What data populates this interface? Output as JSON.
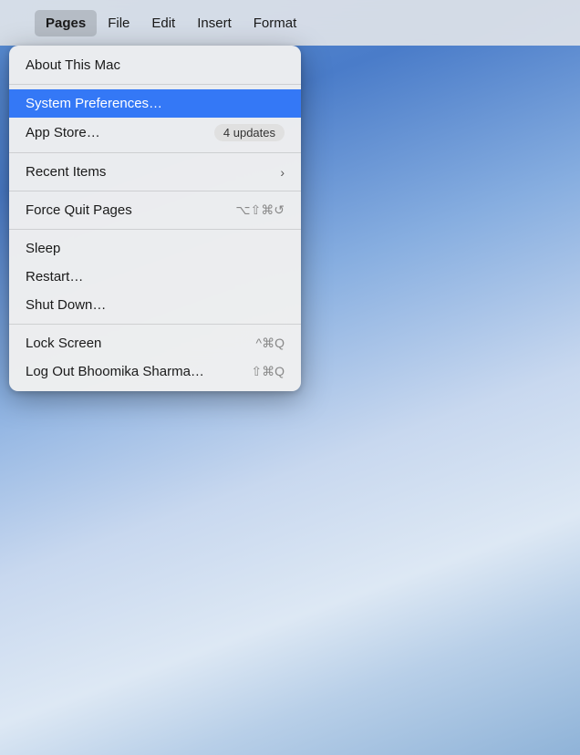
{
  "desktop": {
    "bg_description": "macOS blue sky background"
  },
  "menubar": {
    "apple_symbol": "",
    "items": [
      {
        "id": "pages",
        "label": "Pages",
        "bold": true
      },
      {
        "id": "file",
        "label": "File",
        "bold": false
      },
      {
        "id": "edit",
        "label": "Edit",
        "bold": false
      },
      {
        "id": "insert",
        "label": "Insert",
        "bold": false
      },
      {
        "id": "format",
        "label": "Format",
        "bold": false
      }
    ]
  },
  "dropdown": {
    "items": [
      {
        "id": "about",
        "label": "About This Mac",
        "shortcut": "",
        "badge": "",
        "chevron": false,
        "divider_after": true,
        "highlighted": false,
        "disabled": false
      },
      {
        "id": "system-prefs",
        "label": "System Preferences…",
        "shortcut": "",
        "badge": "",
        "chevron": false,
        "divider_after": false,
        "highlighted": true,
        "disabled": false
      },
      {
        "id": "app-store",
        "label": "App Store…",
        "shortcut": "",
        "badge": "4 updates",
        "chevron": false,
        "divider_after": true,
        "highlighted": false,
        "disabled": false
      },
      {
        "id": "recent-items",
        "label": "Recent Items",
        "shortcut": "",
        "badge": "",
        "chevron": true,
        "divider_after": true,
        "highlighted": false,
        "disabled": false
      },
      {
        "id": "force-quit",
        "label": "Force Quit Pages",
        "shortcut": "⌥⇧⌘↺",
        "badge": "",
        "chevron": false,
        "divider_after": true,
        "highlighted": false,
        "disabled": false
      },
      {
        "id": "sleep",
        "label": "Sleep",
        "shortcut": "",
        "badge": "",
        "chevron": false,
        "divider_after": false,
        "highlighted": false,
        "disabled": false
      },
      {
        "id": "restart",
        "label": "Restart…",
        "shortcut": "",
        "badge": "",
        "chevron": false,
        "divider_after": false,
        "highlighted": false,
        "disabled": false
      },
      {
        "id": "shut-down",
        "label": "Shut Down…",
        "shortcut": "",
        "badge": "",
        "chevron": false,
        "divider_after": true,
        "highlighted": false,
        "disabled": false
      },
      {
        "id": "lock-screen",
        "label": "Lock Screen",
        "shortcut": "^⌘Q",
        "badge": "",
        "chevron": false,
        "divider_after": false,
        "highlighted": false,
        "disabled": false
      },
      {
        "id": "log-out",
        "label": "Log Out Bhoomika Sharma…",
        "shortcut": "⇧⌘Q",
        "badge": "",
        "chevron": false,
        "divider_after": false,
        "highlighted": false,
        "disabled": false
      }
    ]
  }
}
